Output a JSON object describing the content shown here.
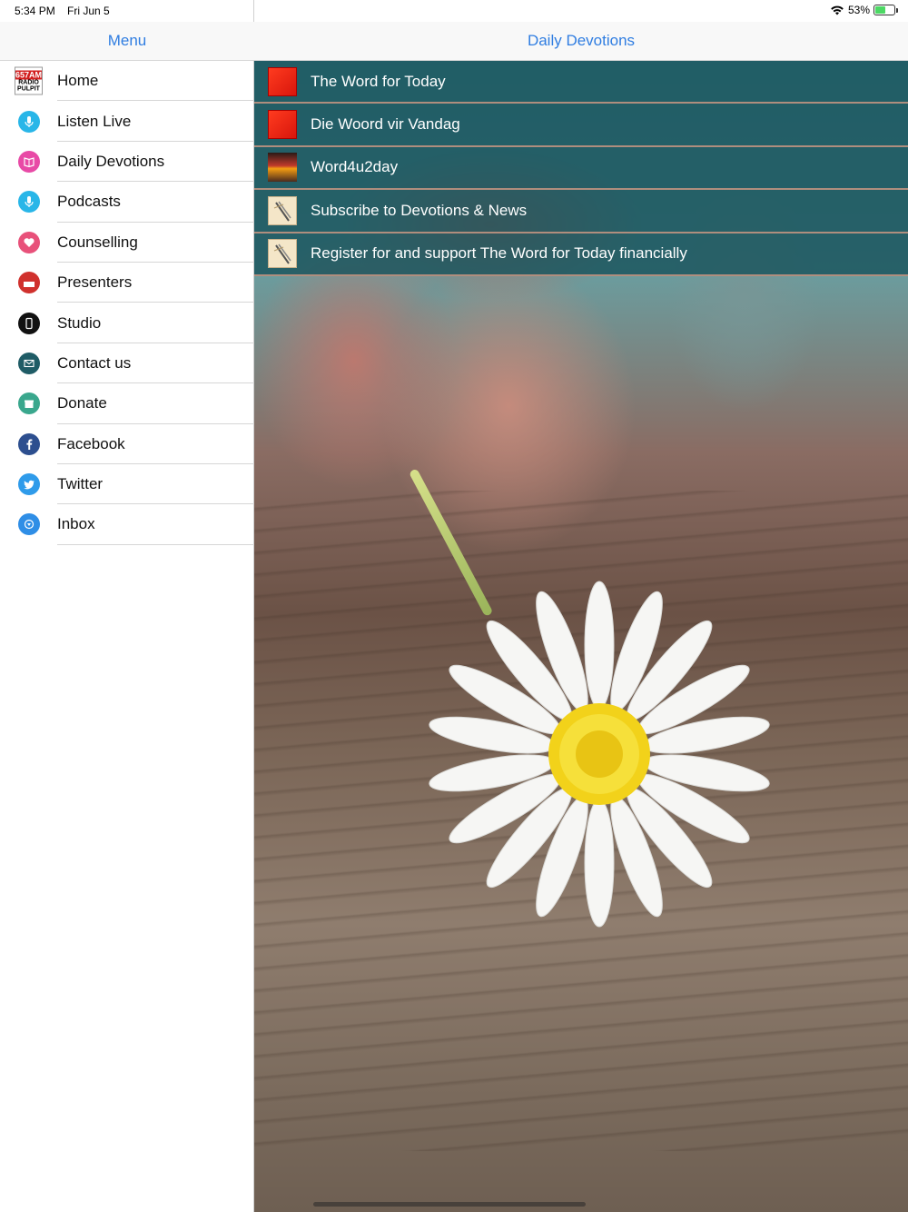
{
  "status_bar": {
    "time": "5:34 PM",
    "date": "Fri Jun 5",
    "battery": "53%",
    "battery_level": 0.53
  },
  "sidebar": {
    "title": "Menu",
    "items": [
      {
        "label": "Home",
        "icon": "radio-pulpit-logo",
        "color": "#d21f1f"
      },
      {
        "label": "Listen Live",
        "icon": "microphone-icon",
        "color": "#29b6e8"
      },
      {
        "label": "Daily Devotions",
        "icon": "book-icon",
        "color": "#e84aa6"
      },
      {
        "label": "Podcasts",
        "icon": "microphone-icon",
        "color": "#29b6e8"
      },
      {
        "label": "Counselling",
        "icon": "heart-icon",
        "color": "#e8517a"
      },
      {
        "label": "Presenters",
        "icon": "presenters-logo-icon",
        "color": "#d0312d"
      },
      {
        "label": "Studio",
        "icon": "phone-icon",
        "color": "#111111"
      },
      {
        "label": "Contact us",
        "icon": "envelope-icon",
        "color": "#1f5c66"
      },
      {
        "label": "Donate",
        "icon": "gift-icon",
        "color": "#3aa78d"
      },
      {
        "label": "Facebook",
        "icon": "facebook-icon",
        "color": "#2d4f8f"
      },
      {
        "label": "Twitter",
        "icon": "twitter-icon",
        "color": "#2f9bea"
      },
      {
        "label": "Inbox",
        "icon": "inbox-icon",
        "color": "#2f8ee6"
      }
    ]
  },
  "main": {
    "title": "Daily Devotions",
    "devotions": [
      {
        "label": "The Word for Today",
        "thumb": "word-for-today-thumb"
      },
      {
        "label": "Die Woord vir Vandag",
        "thumb": "woord-vir-vandag-thumb"
      },
      {
        "label": "Word4u2day",
        "thumb": "word4u2day-thumb"
      },
      {
        "label": "Subscribe to Devotions & News",
        "thumb": "document-thumb"
      },
      {
        "label": "Register for and support The Word for Today financially",
        "thumb": "document-thumb"
      }
    ]
  },
  "colors": {
    "accent": "#2f7de1",
    "row_overlay": "#14505a"
  }
}
